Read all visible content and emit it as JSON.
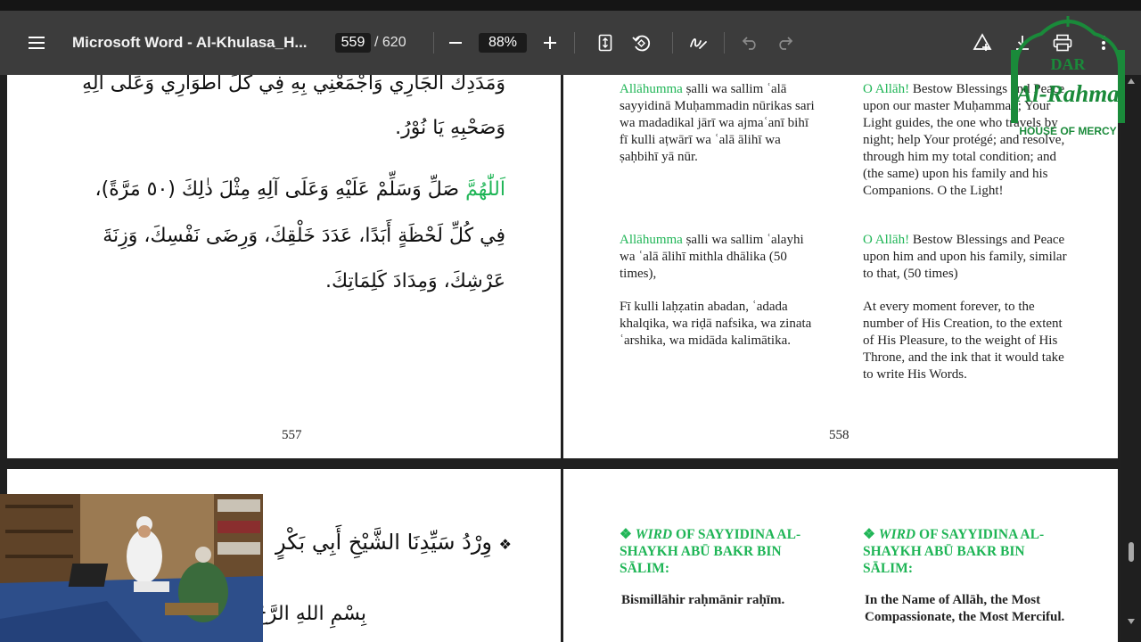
{
  "toolbar": {
    "title": "Microsoft Word - Al-Khulasa_H...",
    "current_page": "559",
    "page_total": "/ 620",
    "zoom": "88%",
    "icons": [
      "menu-icon",
      "zoom-out-icon",
      "zoom-in-icon",
      "fit-page-icon",
      "rotate-icon",
      "draw-icon",
      "undo-icon",
      "redo-icon",
      "add-text-icon",
      "download-icon",
      "print-icon",
      "more-icon"
    ]
  },
  "page557": {
    "arabic_line1": "وَمَدَدِكَ الْجَارِي وَاجْمَعْنِي بِهِ فِي كُلِّ أَطْوَارِي وَعَلَى آلِهِ",
    "arabic_line2": "وَصَحْبِهِ يَا نُوْرُ.",
    "arabic_green": "اَللّٰهُمَّ",
    "arabic_line3": " صَلِّ وَسَلِّمْ عَلَيْهِ وَعَلَى آلِهِ مِثْلَ ذٰلِكَ (٥٠ مَرَّةً)،",
    "arabic_line4": "فِي كُلِّ لَحْظَةٍ أَبَدًا، عَدَدَ خَلْقِكَ، وَرِضَى نَفْسِكَ، وَزِنَةَ",
    "arabic_line5": "عَرْشِكَ، وَمِدَادَ كَلِمَاتِكَ.",
    "number": "557"
  },
  "page558": {
    "block1_translit_green": "Allāhumma",
    "block1_translit_rest": " ṣalli wa sallim ʿalā sayyidinā Muḥammadin nūrikas sari wa madadikal jārī wa ajmaʿanī bihī fī kulli aṭwārī wa ʿalā ālihī wa ṣaḥbihī yā nūr.",
    "block1_english_green": "O Allāh!",
    "block1_english_rest": " Bestow Blessings and Peace upon our master Muḥammad; Your Light guides, the one who travels by night; help Your protégé; and resolve, through him my total condition; and (the same) upon his family and his Companions. O the Light!",
    "block2_translit_green": "Allāhumma",
    "block2_translit_rest": " ṣalli wa sallim ʿalayhi wa ʿalā ālihī mithla dhālika (50 times),",
    "block2_english_green": "O Allāh!",
    "block2_english_rest": " Bestow Blessings and Peace upon him and upon his family, similar to that, (50 times)",
    "block3_translit": "Fī kulli laḥẓatin abadan, ʿadada khalqika, wa riḍā nafsika, wa zinata ʿarshika, wa midāda kalimātika.",
    "block3_english": "At every moment forever, to the number of His Creation, to the extent of His Pleasure, to the weight of His Throne, and the ink that it would take to write His Words.",
    "number": "558"
  },
  "page559": {
    "arabic_heading": "وِرْدُ سَيِّدِنَا الشَّيْخِ أَبِي بَكْرٍ",
    "arabic_bismillah": "بِسْمِ اللهِ الرَّحْ",
    "bullet": "❖"
  },
  "page560": {
    "bullet": "❖",
    "heading_left_em": "WIRD",
    "heading_left_rest": " OF SAYYIDINA AL-SHAYKH ABŪ BAKR BIN SĀLIM:",
    "heading_right_em": "WIRD",
    "heading_right_rest": " OF SAYYIDINA AL-SHAYKH ABŪ BAKR BIN SĀLIM:",
    "translit": "Bismillāhir raḥmānir raḥīm.",
    "english": "In the Name of Allāh, the Most Compassionate, the Most Merciful."
  },
  "logo": {
    "line1": "DAR",
    "line2": "Al-Rahma",
    "line3": "HOUSE OF MERCY",
    "color": "#1a8a3a"
  },
  "colors": {
    "toolbar": "#3c3c3c",
    "accent_green": "#1fb556"
  }
}
